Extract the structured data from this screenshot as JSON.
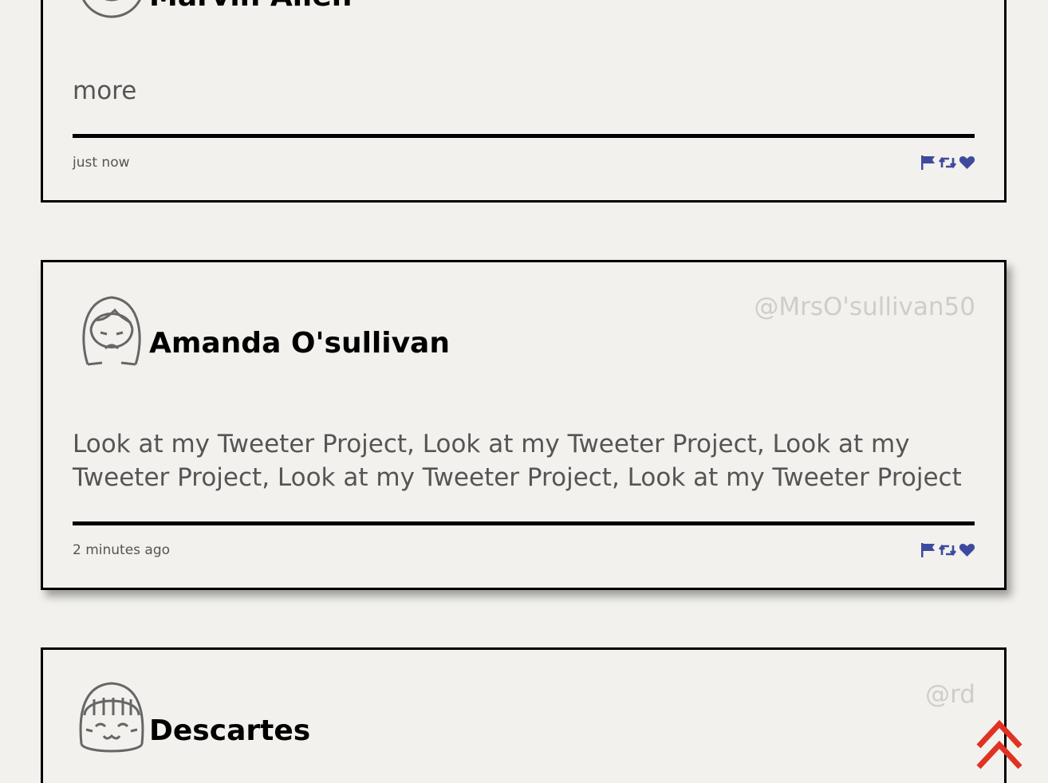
{
  "colors": {
    "background": "#f2f1ed",
    "action_icon": "#3f4a9e",
    "handle_text": "#cfcdc8",
    "scroll_top": "#e03223"
  },
  "tweets": [
    {
      "name": "Marvin Allen",
      "handle": "",
      "content": "more",
      "timestamp": "just now",
      "avatar_icon": "avatar-smile-icon"
    },
    {
      "name": "Amanda O'sullivan",
      "handle": "@MrsO'sullivan50",
      "content": "Look at my Tweeter Project, Look at my Tweeter Project, Look at my Tweeter Project, Look at my Tweeter Project, Look at my Tweeter Project",
      "timestamp": "2 minutes ago",
      "avatar_icon": "avatar-sad-girl-icon"
    },
    {
      "name": "Descartes",
      "handle": "@rd",
      "content": "",
      "timestamp": "",
      "avatar_icon": "avatar-happy-girl-icon"
    }
  ],
  "actions": [
    "flag-icon",
    "retweet-icon",
    "heart-icon"
  ],
  "scroll_top_icon": "double-chevron-up-icon"
}
